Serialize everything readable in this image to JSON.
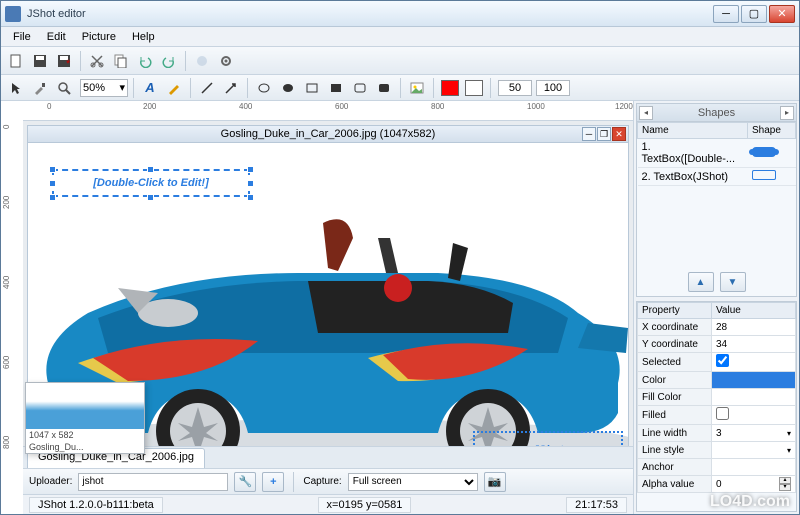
{
  "window": {
    "title": "JShot editor"
  },
  "menu": [
    "File",
    "Edit",
    "Picture",
    "Help"
  ],
  "document": {
    "caption": "Gosling_Duke_in_Car_2006.jpg (1047x582)",
    "tab": "Gosling_Duke_in_Car_2006.jpg",
    "thumb_dims": "1047 x 582",
    "thumb_name": "Gosling_Du..."
  },
  "textboxes": {
    "edit_hint": "[Double-Click to Edit!]",
    "jshot": "JShot"
  },
  "toolbar": {
    "zoom": "50%",
    "size_w": "50",
    "size_h": "100",
    "color1": "#ff0000",
    "color2": "#ffffff"
  },
  "ruler_ticks": [
    "0",
    "200",
    "400",
    "600",
    "800",
    "1000",
    "1200"
  ],
  "vruler_ticks": [
    "0",
    "200",
    "400",
    "600",
    "800"
  ],
  "shapes_panel": {
    "title": "Shapes",
    "col_name": "Name",
    "col_shape": "Shape",
    "rows": [
      {
        "idx": "1.",
        "name": "TextBox([Double-...",
        "selected": true
      },
      {
        "idx": "2.",
        "name": "TextBox(JShot)",
        "selected": false
      }
    ]
  },
  "props": {
    "col_prop": "Property",
    "col_val": "Value",
    "rows": {
      "x": {
        "label": "X coordinate",
        "value": "28"
      },
      "y": {
        "label": "Y coordinate",
        "value": "34"
      },
      "selected": {
        "label": "Selected",
        "value": true
      },
      "color": {
        "label": "Color",
        "value": "#2b7de0"
      },
      "fillcolor": {
        "label": "Fill Color",
        "value": ""
      },
      "filled": {
        "label": "Filled",
        "value": false
      },
      "linewidth": {
        "label": "Line width",
        "value": "3"
      },
      "linestyle": {
        "label": "Line style",
        "value": ""
      },
      "anchor": {
        "label": "Anchor",
        "value": ""
      },
      "alpha": {
        "label": "Alpha value",
        "value": "0"
      }
    }
  },
  "bottom": {
    "uploader_label": "Uploader:",
    "uploader_value": "jshot",
    "capture_label": "Capture:",
    "capture_value": "Full screen"
  },
  "status": {
    "left": "JShot 1.2.0.0-b111:beta",
    "mid": "x=0195 y=0581",
    "right": "21:17:53"
  },
  "watermark": "LO4D.com"
}
